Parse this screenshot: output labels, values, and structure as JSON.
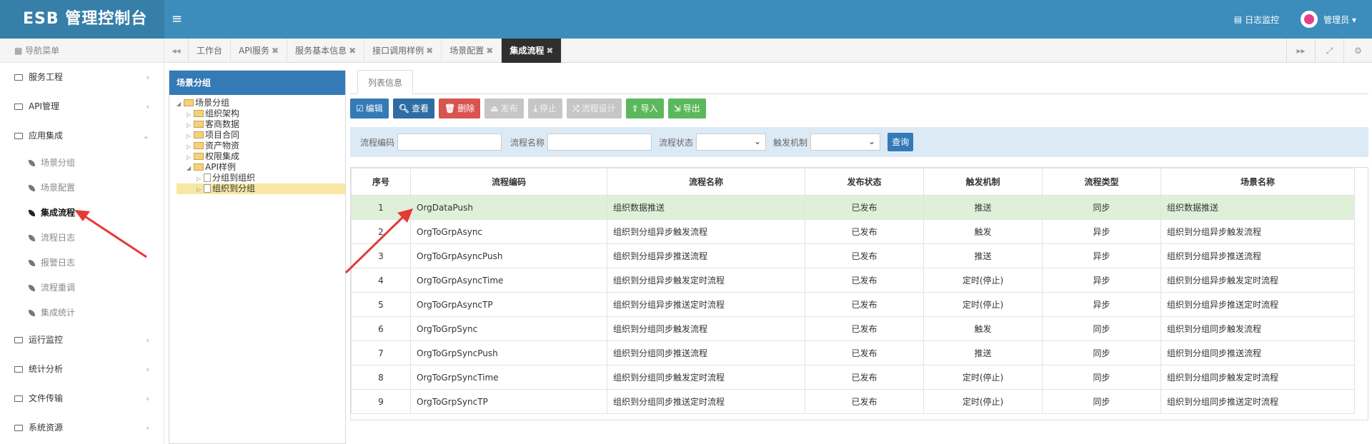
{
  "header": {
    "brand": "ESB 管理控制台",
    "menu_toggle": "≡",
    "log_monitor": "日志监控",
    "user": "管理员 ▾"
  },
  "sidebar": {
    "title": "导航菜单",
    "groups": [
      {
        "label": "服务工程",
        "chevron": "‹"
      },
      {
        "label": "API管理",
        "chevron": "‹"
      },
      {
        "label": "应用集成",
        "chevron": "⌄"
      }
    ],
    "sub_items": [
      "场景分组",
      "场景配置",
      "集成流程",
      "流程日志",
      "报警日志",
      "流程重调",
      "集成统计"
    ],
    "groups_after": [
      {
        "label": "运行监控",
        "chevron": "‹"
      },
      {
        "label": "统计分析",
        "chevron": "‹"
      },
      {
        "label": "文件传输",
        "chevron": "‹"
      },
      {
        "label": "系统资源",
        "chevron": "‹"
      }
    ]
  },
  "tabs": {
    "prev": "◂◂",
    "next": "▸▸",
    "fullscreen": "⤢",
    "settings": "⚙",
    "items": [
      {
        "label": "工作台",
        "close": ""
      },
      {
        "label": "API服务",
        "close": "✖"
      },
      {
        "label": "服务基本信息",
        "close": "✖"
      },
      {
        "label": "接口调用样例",
        "close": "✖"
      },
      {
        "label": "场景配置",
        "close": "✖"
      },
      {
        "label": "集成流程",
        "close": "✖"
      }
    ]
  },
  "tree": {
    "title": "场景分组",
    "root": "场景分组",
    "children": [
      "组织架构",
      "客商数据",
      "项目合同",
      "资产物资",
      "权限集成"
    ],
    "api_node": "API样例",
    "api_children": [
      "分组到组织",
      "组织到分组"
    ]
  },
  "main": {
    "subtab": "列表信息",
    "toolbar": {
      "edit": "编辑",
      "view": "查看",
      "delete": "删除",
      "publish": "发布",
      "stop": "停止",
      "flow_design": "流程设计",
      "import": "导入",
      "export": "导出"
    },
    "search": {
      "code_label": "流程编码",
      "name_label": "流程名称",
      "status_label": "流程状态",
      "trigger_label": "触发机制",
      "query": "查询"
    },
    "table": {
      "columns": [
        "序号",
        "流程编码",
        "流程名称",
        "发布状态",
        "触发机制",
        "流程类型",
        "场景名称"
      ],
      "rows": [
        [
          "1",
          "OrgDataPush",
          "组织数据推送",
          "已发布",
          "推送",
          "同步",
          "组织数据推送"
        ],
        [
          "2",
          "OrgToGrpAsync",
          "组织到分组异步触发流程",
          "已发布",
          "触发",
          "异步",
          "组织到分组异步触发流程"
        ],
        [
          "3",
          "OrgToGrpAsyncPush",
          "组织到分组异步推送流程",
          "已发布",
          "推送",
          "异步",
          "组织到分组异步推送流程"
        ],
        [
          "4",
          "OrgToGrpAsyncTime",
          "组织到分组异步触发定时流程",
          "已发布",
          "定时(停止)",
          "异步",
          "组织到分组异步触发定时流程"
        ],
        [
          "5",
          "OrgToGrpAsyncTP",
          "组织到分组异步推送定时流程",
          "已发布",
          "定时(停止)",
          "异步",
          "组织到分组异步推送定时流程"
        ],
        [
          "6",
          "OrgToGrpSync",
          "组织到分组同步触发流程",
          "已发布",
          "触发",
          "同步",
          "组织到分组同步触发流程"
        ],
        [
          "7",
          "OrgToGrpSyncPush",
          "组织到分组同步推送流程",
          "已发布",
          "推送",
          "同步",
          "组织到分组同步推送流程"
        ],
        [
          "8",
          "OrgToGrpSyncTime",
          "组织到分组同步触发定时流程",
          "已发布",
          "定时(停止)",
          "同步",
          "组织到分组同步触发定时流程"
        ],
        [
          "9",
          "OrgToGrpSyncTP",
          "组织到分组同步推送定时流程",
          "已发布",
          "定时(停止)",
          "同步",
          "组织到分组同步推送定时流程"
        ]
      ]
    }
  },
  "colors": {
    "header": "#3c8dbc",
    "brand_bg": "#367fa9",
    "highlight_row": "#dff0d8",
    "annotation_red": "#e53935"
  }
}
